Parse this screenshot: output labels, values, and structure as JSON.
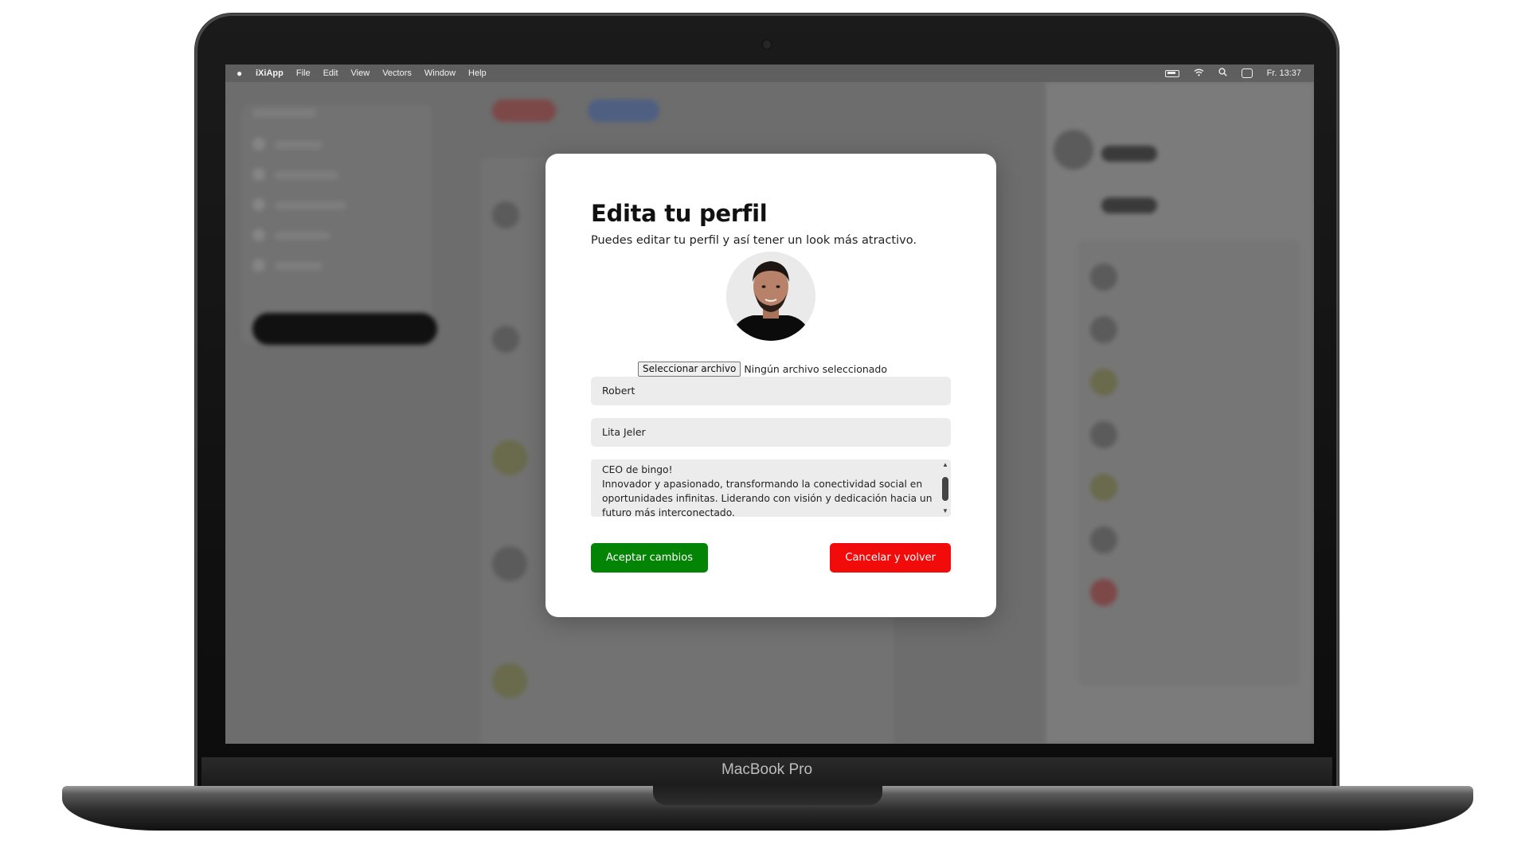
{
  "device": {
    "brand_label": "MacBook Pro"
  },
  "menubar": {
    "app_name": "iXiApp",
    "items": [
      "File",
      "Edit",
      "View",
      "Vectors",
      "Window",
      "Help"
    ],
    "clock": "Fr. 13:37"
  },
  "modal": {
    "title": "Edita tu perfil",
    "subtitle": "Puedes editar tu perfil y así tener un look más atractivo.",
    "file_button_label": "Seleccionar archivo",
    "file_status": "Ningún archivo seleccionado",
    "first_name_value": "Robert",
    "last_name_value": "Lita Jeler",
    "bio_lines": [
      "CEO de bingo!",
      "Innovador y apasionado, transformando la conectividad social en",
      "oportunidades infinitas. Liderando con visión y dedicación hacia un",
      "futuro más interconectado."
    ],
    "accept_label": "Aceptar cambios",
    "cancel_label": "Cancelar y volver"
  },
  "colors": {
    "accept": "#048404",
    "cancel": "#f10b0b"
  },
  "icons": [
    "apple-logo-icon",
    "battery-icon",
    "wifi-icon",
    "search-icon",
    "control-center-icon",
    "scroll-up-arrow-icon",
    "scroll-down-arrow-icon"
  ]
}
